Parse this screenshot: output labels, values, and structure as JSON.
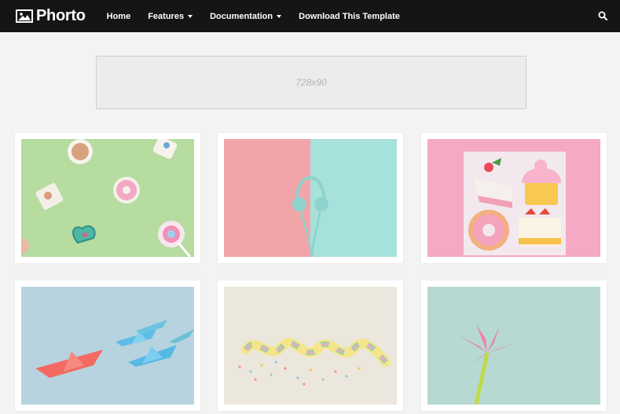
{
  "header": {
    "brand": "Phorto",
    "nav": [
      {
        "label": "Home",
        "has_dropdown": false
      },
      {
        "label": "Features",
        "has_dropdown": true
      },
      {
        "label": "Documentation",
        "has_dropdown": true
      },
      {
        "label": "Download This Template",
        "has_dropdown": false
      }
    ],
    "search_icon": "search-icon"
  },
  "ad": {
    "label": "728x90"
  },
  "posts": [
    {
      "name": "donuts-candy-on-green"
    },
    {
      "name": "headphones-pink-mint"
    },
    {
      "name": "cakes-on-pink"
    },
    {
      "name": "paper-boats"
    },
    {
      "name": "rainbow-ribbon-sprinkles"
    },
    {
      "name": "origami-pink-flower"
    }
  ],
  "colors": {
    "topbar": "#151515",
    "background": "#f3f3f3",
    "card": "#ffffff"
  }
}
